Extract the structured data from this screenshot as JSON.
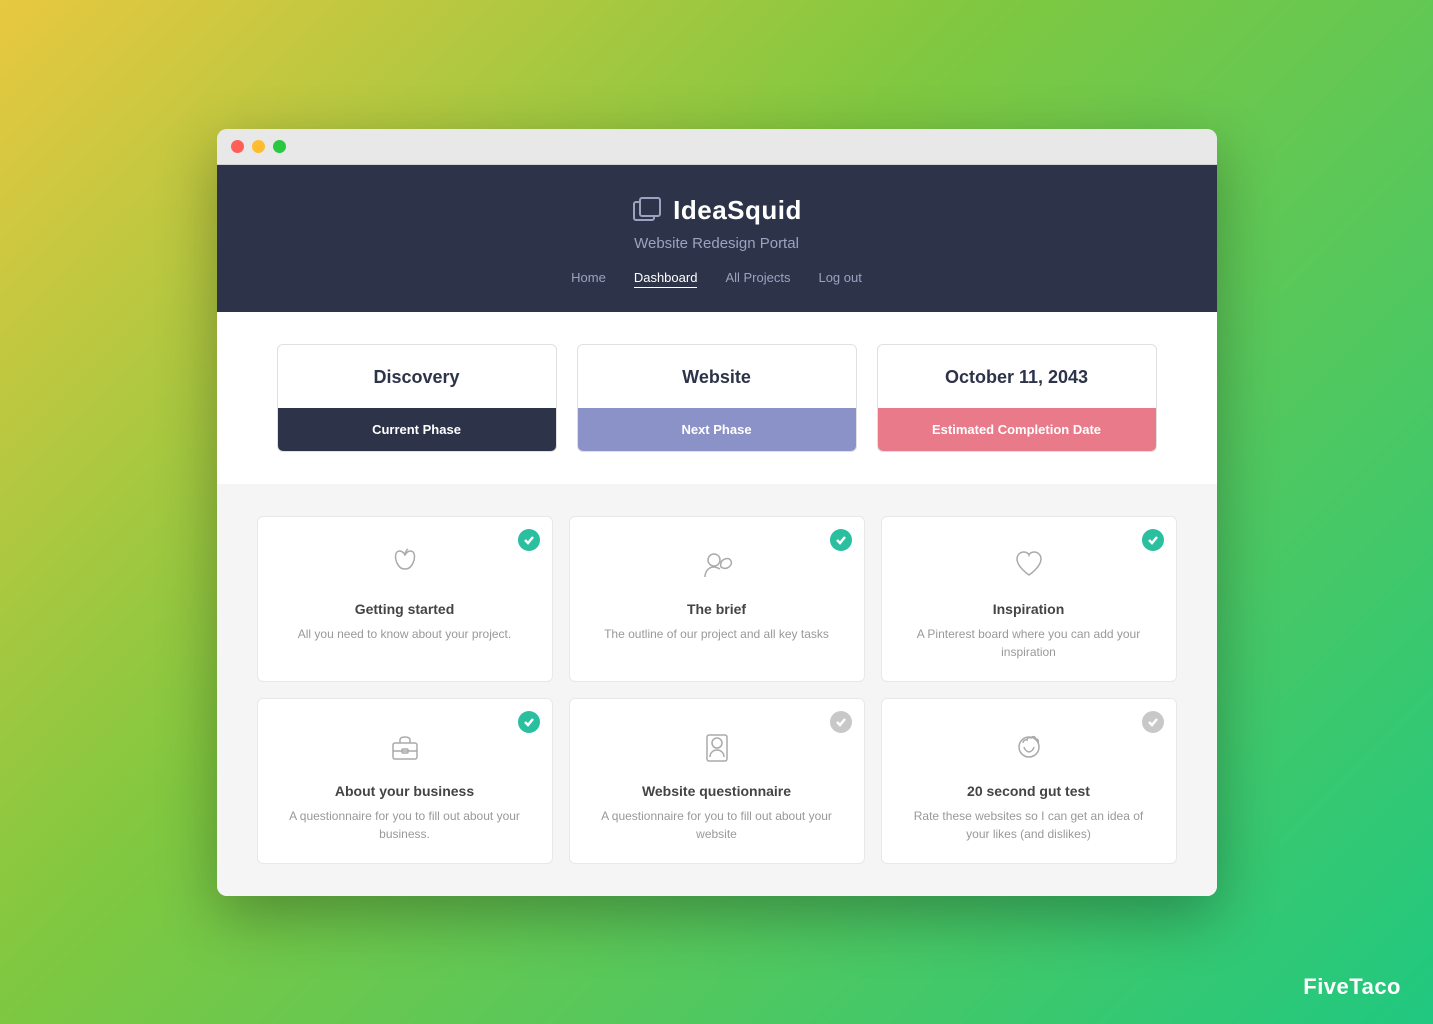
{
  "window": {
    "titlebar": {
      "traffic_lights": [
        "red",
        "yellow",
        "green"
      ]
    }
  },
  "header": {
    "logo_text": "IdeaSquid",
    "subtitle": "Website Redesign Portal",
    "nav": [
      {
        "label": "Home",
        "active": false
      },
      {
        "label": "Dashboard",
        "active": true
      },
      {
        "label": "All Projects",
        "active": false
      },
      {
        "label": "Log out",
        "active": false
      }
    ]
  },
  "phases": [
    {
      "title": "Discovery",
      "badge": "Current Phase",
      "badge_type": "dark"
    },
    {
      "title": "Website",
      "badge": "Next Phase",
      "badge_type": "blue"
    },
    {
      "title": "October 11, 2043",
      "badge": "Estimated Completion Date",
      "badge_type": "pink"
    }
  ],
  "tasks": [
    {
      "name": "Getting started",
      "desc": "All you need to know about your project.",
      "complete": true,
      "icon": "apple"
    },
    {
      "name": "The brief",
      "desc": "The outline of our project and all key tasks",
      "complete": true,
      "icon": "person-leaf"
    },
    {
      "name": "Inspiration",
      "desc": "A Pinterest board where you can add your inspiration",
      "complete": true,
      "icon": "heart"
    },
    {
      "name": "About your business",
      "desc": "A questionnaire for you to fill out about your business.",
      "complete": true,
      "icon": "briefcase"
    },
    {
      "name": "Website questionnaire",
      "desc": "A questionnaire for you to fill out about your website",
      "complete": false,
      "icon": "person-form"
    },
    {
      "name": "20 second gut test",
      "desc": "Rate these websites so I can get an idea of your likes (and dislikes)",
      "complete": false,
      "icon": "brain"
    }
  ],
  "footer": {
    "brand": "FiveTaco"
  }
}
